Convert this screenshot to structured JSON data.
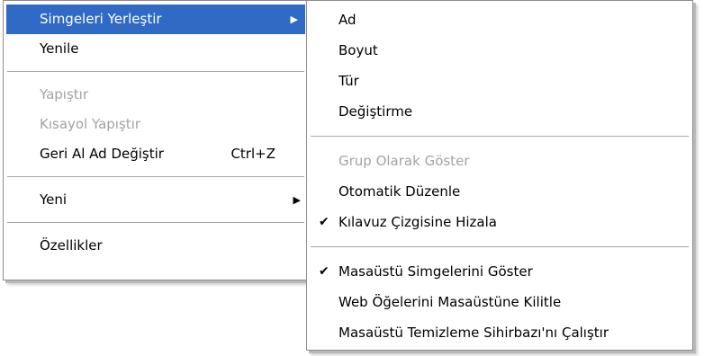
{
  "main_menu": {
    "items": [
      {
        "label": "Simgeleri Yerleştir",
        "state": "highlighted",
        "has_submenu": true
      },
      {
        "label": "Yenile",
        "state": "enabled"
      },
      {
        "label": "Yapıştır",
        "state": "disabled"
      },
      {
        "label": "Kısayol Yapıştır",
        "state": "disabled"
      },
      {
        "label": "Geri Al Ad Değiştir",
        "shortcut": "Ctrl+Z",
        "state": "enabled"
      },
      {
        "label": "Yeni",
        "state": "enabled",
        "has_submenu": true
      },
      {
        "label": "Özellikler",
        "state": "enabled"
      }
    ],
    "submenu_arrow": "▶"
  },
  "sub_menu": {
    "items": [
      {
        "label": "Ad",
        "state": "enabled"
      },
      {
        "label": "Boyut",
        "state": "enabled"
      },
      {
        "label": "Tür",
        "state": "enabled"
      },
      {
        "label": "Değiştirme",
        "state": "enabled"
      },
      {
        "label": "Grup Olarak Göster",
        "state": "disabled"
      },
      {
        "label": "Otomatik Düzenle",
        "state": "enabled"
      },
      {
        "label": "Kılavuz Çizgisine Hizala",
        "state": "checked"
      },
      {
        "label": "Masaüstü Simgelerini Göster",
        "state": "checked"
      },
      {
        "label": "Web Öğelerini Masaüstüne Kilitle",
        "state": "enabled"
      },
      {
        "label": "Masaüstü Temizleme Sihirbazı'nı Çalıştır",
        "state": "enabled"
      }
    ],
    "check_glyph": "✔"
  },
  "colors": {
    "highlight_bg": "#316ac5",
    "disabled_text": "#a3a3a3",
    "menu_border": "#8c8c8c"
  }
}
